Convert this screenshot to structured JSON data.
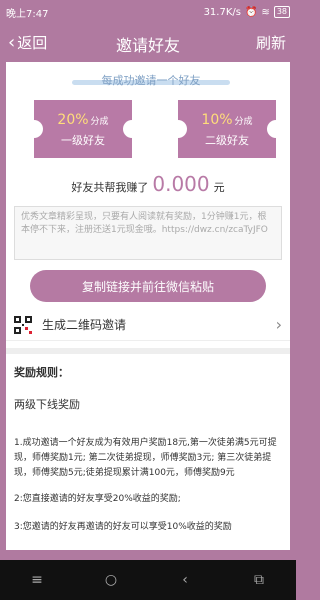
{
  "status": {
    "time": "晚上7:47",
    "speed": "31.7K/s",
    "battery": "38"
  },
  "header": {
    "back_label": "返回",
    "title": "邀请好友",
    "refresh_label": "刷新"
  },
  "promo": {
    "headline": "每成功邀请一个好友",
    "tiers": [
      {
        "percent": "20%",
        "unit": "分成",
        "level": "一级好友"
      },
      {
        "percent": "10%",
        "unit": "分成",
        "level": "二级好友"
      }
    ]
  },
  "earnings": {
    "prefix": "好友共帮我赚了",
    "amount": "0.000",
    "currency": "元"
  },
  "share_text": "优秀文章精彩呈现，只要有人阅读就有奖励，1分钟赚1元，根本停不下来，注册还送1元现金哦。https://dwz.cn/zcaTyJFO",
  "copy_button": "复制链接并前往微信粘贴",
  "qr_row": {
    "label": "生成二维码邀请"
  },
  "rules": {
    "title": "奖励规则：",
    "subtitle": "两级下线奖励",
    "items": [
      "1.成功邀请一个好友成为有效用户奖励18元,第一次徒弟满5元可提现，师傅奖励1元; 第二次徒弟提现，师傅奖励3元; 第三次徒弟提现，师傅奖励5元;徒弟提现累计满100元，师傅奖励9元",
      "2:您直接邀请的好友享受20%收益的奖励;",
      "3:您邀请的好友再邀请的好友可以享受10%收益的奖励"
    ]
  },
  "colors": {
    "accent": "#b07aa0",
    "ticket": "#b87aa6",
    "highlight": "#ffdd7a"
  }
}
